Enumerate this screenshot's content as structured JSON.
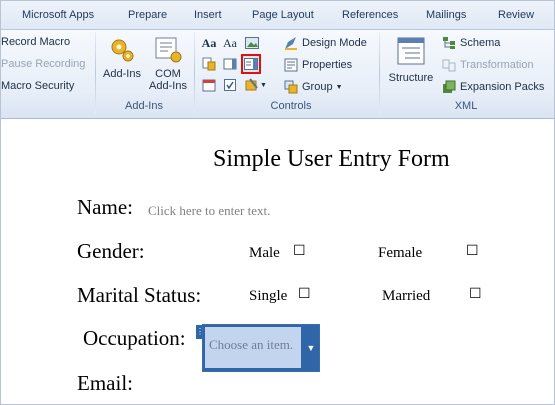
{
  "tabs": [
    "Microsoft Apps",
    "Prepare",
    "Insert",
    "Page Layout",
    "References",
    "Mailings",
    "Review"
  ],
  "code_group": {
    "record_macro": "Record Macro",
    "pause_recording": "Pause Recording",
    "macro_security": "Macro Security"
  },
  "addins_group": {
    "addins_label": "Add-Ins",
    "com_addins_line1": "COM",
    "com_addins_line2": "Add-Ins",
    "group_label": "Add-Ins"
  },
  "controls_group": {
    "aa_rich": "Aa",
    "aa_plain": "Aa",
    "design_mode": "Design Mode",
    "properties": "Properties",
    "group": "Group",
    "group_label": "Controls"
  },
  "xml_group": {
    "structure": "Structure",
    "schema": "Schema",
    "transformation": "Transformation",
    "expansion_packs": "Expansion Packs",
    "group_label": "XML"
  },
  "doc": {
    "title": "Simple User Entry Form",
    "name_label": "Name:",
    "name_placeholder": "Click here to enter text.",
    "gender_label": "Gender:",
    "male": "Male",
    "female": "Female",
    "marital_label": "Marital Status:",
    "single": "Single",
    "married": "Married",
    "occupation_label": "Occupation:",
    "occupation_placeholder": "Choose an item.",
    "email_label": "Email:",
    "checkbox_glyph": "☐"
  }
}
